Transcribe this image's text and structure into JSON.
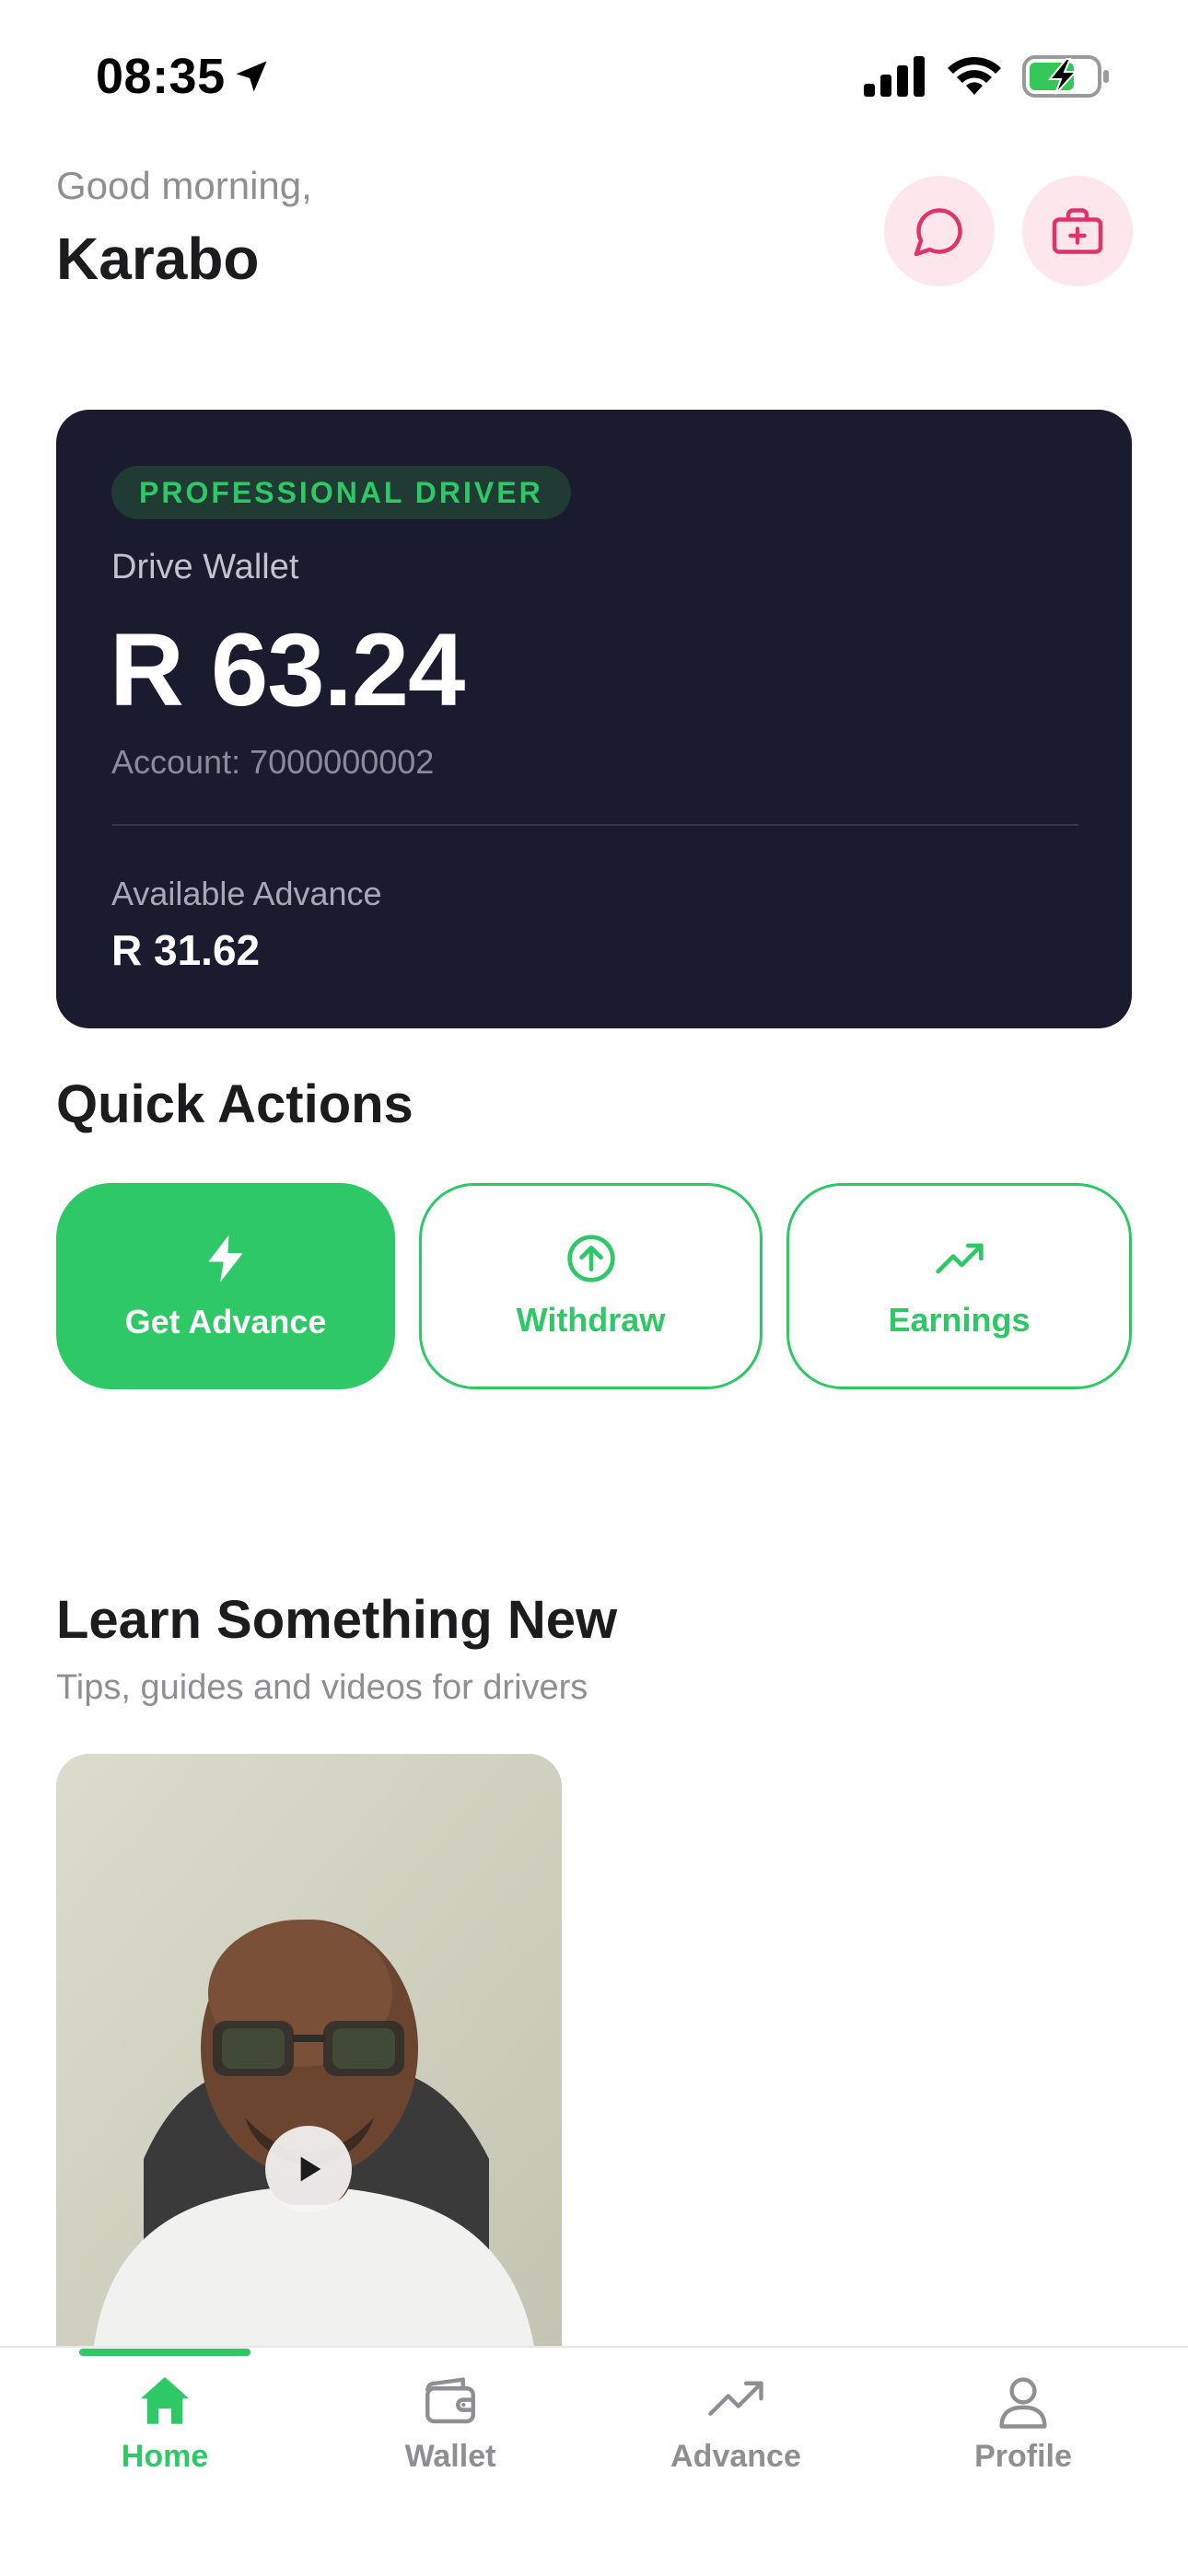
{
  "status_bar": {
    "time": "08:35"
  },
  "header": {
    "greeting": "Good morning,",
    "user_name": "Karabo"
  },
  "wallet_card": {
    "badge": "PROFESSIONAL DRIVER",
    "label": "Drive Wallet",
    "balance": "R 63.24",
    "account": "Account: 7000000002",
    "advance_label": "Available Advance",
    "advance_amount": "R 31.62"
  },
  "quick_actions": {
    "title": "Quick Actions",
    "items": [
      {
        "label": "Get Advance",
        "icon": "lightning-icon"
      },
      {
        "label": "Withdraw",
        "icon": "arrow-up-circle-icon"
      },
      {
        "label": "Earnings",
        "icon": "trending-up-icon"
      }
    ]
  },
  "learn": {
    "title": "Learn Something New",
    "subtitle": "Tips, guides and videos for drivers"
  },
  "tab_bar": {
    "items": [
      {
        "label": "Home",
        "icon": "home-icon",
        "active": true
      },
      {
        "label": "Wallet",
        "icon": "wallet-icon",
        "active": false
      },
      {
        "label": "Advance",
        "icon": "trending-up-icon",
        "active": false
      },
      {
        "label": "Profile",
        "icon": "user-icon",
        "active": false
      }
    ]
  },
  "colors": {
    "accent": "#2ec866",
    "card_background": "#1b1b2f",
    "pink_accent": "#e0336e",
    "pink_background": "#fde7ec"
  }
}
